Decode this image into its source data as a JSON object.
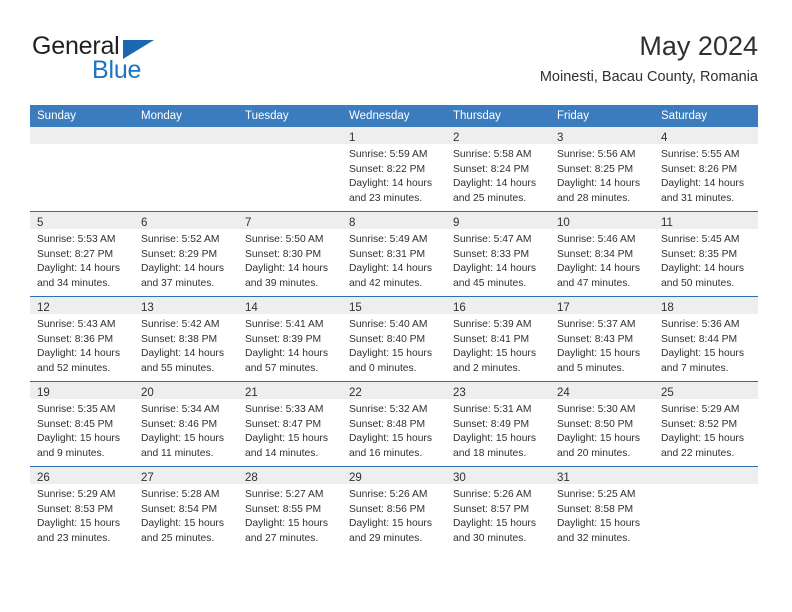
{
  "brand": {
    "general_text": "General",
    "blue_text": "Blue",
    "triangle_color": "#1c68b0",
    "blue_color": "#1c75c4"
  },
  "header": {
    "title": "May 2024",
    "subtitle": "Moinesti, Bacau County, Romania"
  },
  "theme": {
    "header_bg": "#3a7cbe",
    "row_divider": "#2f6cb0",
    "daynum_band_bg": "#eeeeee",
    "text": "#303030"
  },
  "weekday_headers": [
    "Sunday",
    "Monday",
    "Tuesday",
    "Wednesday",
    "Thursday",
    "Friday",
    "Saturday"
  ],
  "weeks": [
    [
      {
        "day": "",
        "lines": []
      },
      {
        "day": "",
        "lines": []
      },
      {
        "day": "",
        "lines": []
      },
      {
        "day": "1",
        "lines": [
          "Sunrise: 5:59 AM",
          "Sunset: 8:22 PM",
          "Daylight: 14 hours",
          "and 23 minutes."
        ]
      },
      {
        "day": "2",
        "lines": [
          "Sunrise: 5:58 AM",
          "Sunset: 8:24 PM",
          "Daylight: 14 hours",
          "and 25 minutes."
        ]
      },
      {
        "day": "3",
        "lines": [
          "Sunrise: 5:56 AM",
          "Sunset: 8:25 PM",
          "Daylight: 14 hours",
          "and 28 minutes."
        ]
      },
      {
        "day": "4",
        "lines": [
          "Sunrise: 5:55 AM",
          "Sunset: 8:26 PM",
          "Daylight: 14 hours",
          "and 31 minutes."
        ]
      }
    ],
    [
      {
        "day": "5",
        "lines": [
          "Sunrise: 5:53 AM",
          "Sunset: 8:27 PM",
          "Daylight: 14 hours",
          "and 34 minutes."
        ]
      },
      {
        "day": "6",
        "lines": [
          "Sunrise: 5:52 AM",
          "Sunset: 8:29 PM",
          "Daylight: 14 hours",
          "and 37 minutes."
        ]
      },
      {
        "day": "7",
        "lines": [
          "Sunrise: 5:50 AM",
          "Sunset: 8:30 PM",
          "Daylight: 14 hours",
          "and 39 minutes."
        ]
      },
      {
        "day": "8",
        "lines": [
          "Sunrise: 5:49 AM",
          "Sunset: 8:31 PM",
          "Daylight: 14 hours",
          "and 42 minutes."
        ]
      },
      {
        "day": "9",
        "lines": [
          "Sunrise: 5:47 AM",
          "Sunset: 8:33 PM",
          "Daylight: 14 hours",
          "and 45 minutes."
        ]
      },
      {
        "day": "10",
        "lines": [
          "Sunrise: 5:46 AM",
          "Sunset: 8:34 PM",
          "Daylight: 14 hours",
          "and 47 minutes."
        ]
      },
      {
        "day": "11",
        "lines": [
          "Sunrise: 5:45 AM",
          "Sunset: 8:35 PM",
          "Daylight: 14 hours",
          "and 50 minutes."
        ]
      }
    ],
    [
      {
        "day": "12",
        "lines": [
          "Sunrise: 5:43 AM",
          "Sunset: 8:36 PM",
          "Daylight: 14 hours",
          "and 52 minutes."
        ]
      },
      {
        "day": "13",
        "lines": [
          "Sunrise: 5:42 AM",
          "Sunset: 8:38 PM",
          "Daylight: 14 hours",
          "and 55 minutes."
        ]
      },
      {
        "day": "14",
        "lines": [
          "Sunrise: 5:41 AM",
          "Sunset: 8:39 PM",
          "Daylight: 14 hours",
          "and 57 minutes."
        ]
      },
      {
        "day": "15",
        "lines": [
          "Sunrise: 5:40 AM",
          "Sunset: 8:40 PM",
          "Daylight: 15 hours",
          "and 0 minutes."
        ]
      },
      {
        "day": "16",
        "lines": [
          "Sunrise: 5:39 AM",
          "Sunset: 8:41 PM",
          "Daylight: 15 hours",
          "and 2 minutes."
        ]
      },
      {
        "day": "17",
        "lines": [
          "Sunrise: 5:37 AM",
          "Sunset: 8:43 PM",
          "Daylight: 15 hours",
          "and 5 minutes."
        ]
      },
      {
        "day": "18",
        "lines": [
          "Sunrise: 5:36 AM",
          "Sunset: 8:44 PM",
          "Daylight: 15 hours",
          "and 7 minutes."
        ]
      }
    ],
    [
      {
        "day": "19",
        "lines": [
          "Sunrise: 5:35 AM",
          "Sunset: 8:45 PM",
          "Daylight: 15 hours",
          "and 9 minutes."
        ]
      },
      {
        "day": "20",
        "lines": [
          "Sunrise: 5:34 AM",
          "Sunset: 8:46 PM",
          "Daylight: 15 hours",
          "and 11 minutes."
        ]
      },
      {
        "day": "21",
        "lines": [
          "Sunrise: 5:33 AM",
          "Sunset: 8:47 PM",
          "Daylight: 15 hours",
          "and 14 minutes."
        ]
      },
      {
        "day": "22",
        "lines": [
          "Sunrise: 5:32 AM",
          "Sunset: 8:48 PM",
          "Daylight: 15 hours",
          "and 16 minutes."
        ]
      },
      {
        "day": "23",
        "lines": [
          "Sunrise: 5:31 AM",
          "Sunset: 8:49 PM",
          "Daylight: 15 hours",
          "and 18 minutes."
        ]
      },
      {
        "day": "24",
        "lines": [
          "Sunrise: 5:30 AM",
          "Sunset: 8:50 PM",
          "Daylight: 15 hours",
          "and 20 minutes."
        ]
      },
      {
        "day": "25",
        "lines": [
          "Sunrise: 5:29 AM",
          "Sunset: 8:52 PM",
          "Daylight: 15 hours",
          "and 22 minutes."
        ]
      }
    ],
    [
      {
        "day": "26",
        "lines": [
          "Sunrise: 5:29 AM",
          "Sunset: 8:53 PM",
          "Daylight: 15 hours",
          "and 23 minutes."
        ]
      },
      {
        "day": "27",
        "lines": [
          "Sunrise: 5:28 AM",
          "Sunset: 8:54 PM",
          "Daylight: 15 hours",
          "and 25 minutes."
        ]
      },
      {
        "day": "28",
        "lines": [
          "Sunrise: 5:27 AM",
          "Sunset: 8:55 PM",
          "Daylight: 15 hours",
          "and 27 minutes."
        ]
      },
      {
        "day": "29",
        "lines": [
          "Sunrise: 5:26 AM",
          "Sunset: 8:56 PM",
          "Daylight: 15 hours",
          "and 29 minutes."
        ]
      },
      {
        "day": "30",
        "lines": [
          "Sunrise: 5:26 AM",
          "Sunset: 8:57 PM",
          "Daylight: 15 hours",
          "and 30 minutes."
        ]
      },
      {
        "day": "31",
        "lines": [
          "Sunrise: 5:25 AM",
          "Sunset: 8:58 PM",
          "Daylight: 15 hours",
          "and 32 minutes."
        ]
      },
      {
        "day": "",
        "lines": []
      }
    ]
  ]
}
